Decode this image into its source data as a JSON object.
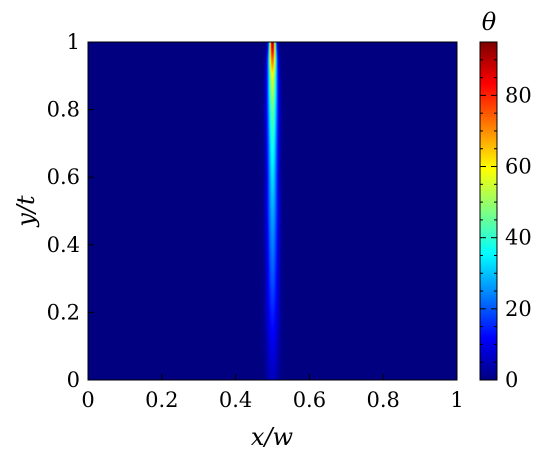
{
  "chart_data": {
    "type": "heatmap",
    "title": "",
    "xlabel": "x/w",
    "ylabel": "y/t",
    "xlim": [
      0,
      1
    ],
    "ylim": [
      0,
      1
    ],
    "x_ticks": [
      "0",
      "0.2",
      "0.4",
      "0.6",
      "0.8",
      "1"
    ],
    "y_ticks": [
      "0",
      "0.2",
      "0.4",
      "0.6",
      "0.8",
      "1"
    ],
    "colormap": "jet",
    "colorbar": {
      "label": "θ",
      "range": [
        0,
        95
      ],
      "ticks": [
        "0",
        "20",
        "40",
        "60",
        "80"
      ],
      "tick_values": [
        0,
        20,
        40,
        60,
        80
      ]
    },
    "field": {
      "description_of_values": "narrow vertical plume centered at x/w = 0.5, peak at y/t = 1",
      "center_x": 0.5,
      "peak_value": 95,
      "peak_y": 1.0,
      "profile": [
        {
          "y": 1.0,
          "center_value": 95,
          "half_width_x": 0.006
        },
        {
          "y": 0.95,
          "center_value": 75,
          "half_width_x": 0.008
        },
        {
          "y": 0.9,
          "center_value": 58,
          "half_width_x": 0.009
        },
        {
          "y": 0.8,
          "center_value": 45,
          "half_width_x": 0.01
        },
        {
          "y": 0.7,
          "center_value": 38,
          "half_width_x": 0.01
        },
        {
          "y": 0.6,
          "center_value": 33,
          "half_width_x": 0.01
        },
        {
          "y": 0.5,
          "center_value": 28,
          "half_width_x": 0.011
        },
        {
          "y": 0.4,
          "center_value": 24,
          "half_width_x": 0.011
        },
        {
          "y": 0.3,
          "center_value": 20,
          "half_width_x": 0.011
        },
        {
          "y": 0.2,
          "center_value": 15,
          "half_width_x": 0.012
        },
        {
          "y": 0.1,
          "center_value": 10,
          "half_width_x": 0.012
        },
        {
          "y": 0.0,
          "center_value": 6,
          "half_width_x": 0.012
        }
      ]
    }
  },
  "colors": {
    "background_min": "#00007f",
    "max": "#7f0000"
  }
}
